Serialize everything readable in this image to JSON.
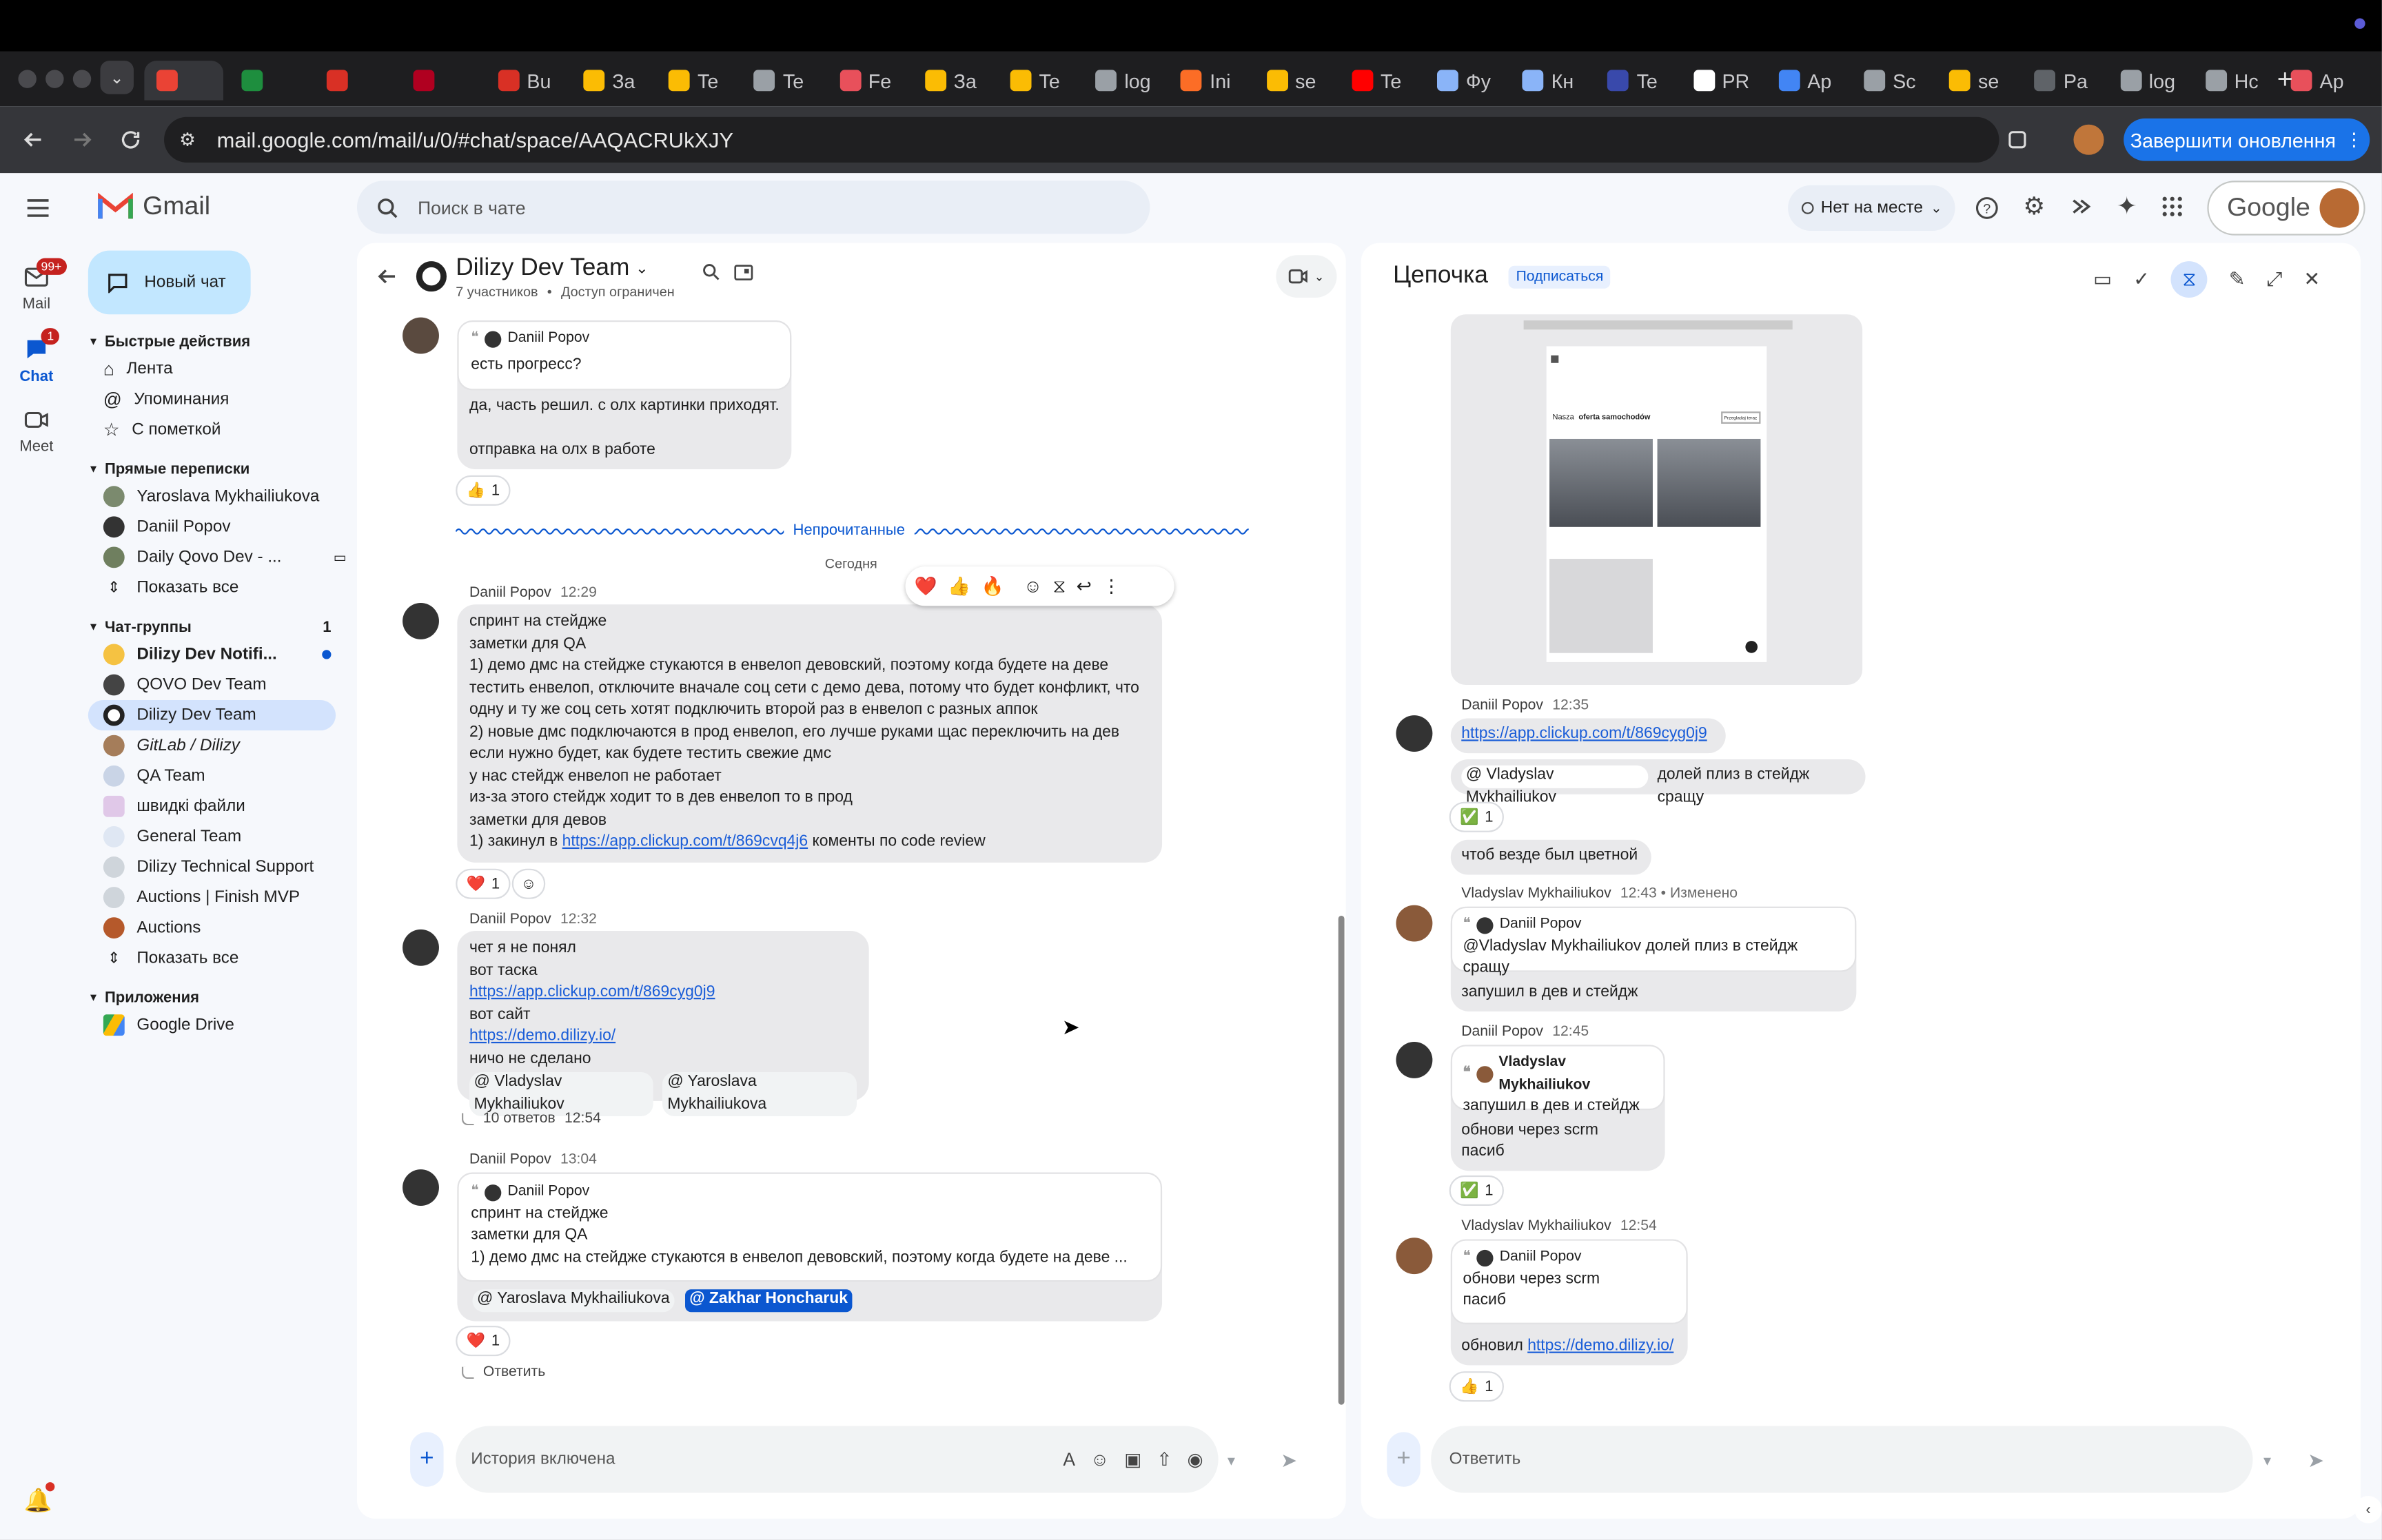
{
  "browser": {
    "tabs": [
      {
        "label": "",
        "color": "#ea4335"
      },
      {
        "label": "",
        "color": "#1e8e3e"
      },
      {
        "label": "",
        "color": "#d93025"
      },
      {
        "label": "",
        "color": "#b00020"
      },
      {
        "label": "Bu",
        "color": "#d93025"
      },
      {
        "label": "За",
        "color": "#fbbc04"
      },
      {
        "label": "Te",
        "color": "#fbbc04"
      },
      {
        "label": "Te",
        "color": "#9aa0a6"
      },
      {
        "label": "Fe",
        "color": "#e8505b"
      },
      {
        "label": "За",
        "color": "#fbbc04"
      },
      {
        "label": "Te",
        "color": "#fbbc04"
      },
      {
        "label": "log",
        "color": "#9aa0a6"
      },
      {
        "label": "Ini",
        "color": "#fc6d26"
      },
      {
        "label": "se",
        "color": "#fbbc04"
      },
      {
        "label": "Te",
        "color": "#ff0000"
      },
      {
        "label": "Фу",
        "color": "#8ab4f8"
      },
      {
        "label": "Кн",
        "color": "#8ab4f8"
      },
      {
        "label": "Te",
        "color": "#3949ab"
      },
      {
        "label": "PR",
        "color": "#ffffff"
      },
      {
        "label": "Ap",
        "color": "#4285f4"
      },
      {
        "label": "Sc",
        "color": "#9aa0a6"
      },
      {
        "label": "se",
        "color": "#fbbc04"
      },
      {
        "label": "Pa",
        "color": "#5f6368"
      },
      {
        "label": "log",
        "color": "#9aa0a6"
      },
      {
        "label": "Hc",
        "color": "#9aa0a6"
      },
      {
        "label": "Ap",
        "color": "#e8505b"
      }
    ],
    "new_tab": "+",
    "url": "mail.google.com/mail/u/0/#chat/space/AAQACRUkXJY",
    "update_button": "Завершити оновлення"
  },
  "gmail": {
    "logo_text": "Gmail",
    "search_placeholder": "Поиск в чате",
    "status": "Нет на месте",
    "google_text": "Google",
    "rail": {
      "mail": "Mail",
      "mail_badge": "99+",
      "chat": "Chat",
      "chat_badge": "1",
      "meet": "Meet"
    },
    "new_chat": "Новый чат",
    "sections": {
      "quick": "Быстрые действия",
      "quick_items": [
        "Лента",
        "Упоминания",
        "С пометкой"
      ],
      "dm": "Прямые переписки",
      "dm_items": [
        "Yaroslava Mykhailiukova",
        "Daniil Popov",
        "Daily Qovo Dev - ..."
      ],
      "show_all": "Показать все",
      "groups": "Чат-группы",
      "groups_count": "1",
      "group_items": [
        "Dilizy Dev Notifi...",
        "QOVO Dev Team",
        "Dilizy Dev Team",
        "GitLab / Dilizy",
        "QA Team",
        "швидкі файли",
        "General Team",
        "Dilizy Technical Support",
        "Auctions | Finish MVP",
        "Auctions"
      ],
      "apps": "Приложения",
      "app_items": [
        "Google Drive"
      ]
    }
  },
  "chat": {
    "title": "Dilizy Dev Team",
    "subtitle_members": "7 участников",
    "subtitle_access": "Доступ ограничен",
    "unread_label": "Непрочитанные",
    "today_label": "Сегодня",
    "msg0": {
      "quote_author": "Daniil Popov",
      "quote_text": "есть прогресс?",
      "line1": "да, часть решил. с олх картинки приходят.",
      "line2": "отправка на олх в работе",
      "reaction": "1"
    },
    "msg1": {
      "author": "Daniil Popov",
      "time": "12:29",
      "lines": [
        "спринт на стейдже",
        "заметки для QA",
        "1) демо дмс на стейдже стукаются в енвелоп девовский, поэтому когда будете на деве",
        "тестить енвелоп, отключите вначале соц сети с демо дева, потому что будет конфликт, что",
        "одну и ту же соц сеть хотят подключить второй раз в енвелоп с разных аппок",
        "2) новые дмс подключаются в прод енвелоп, его лучше руками щас переключить на дев",
        "если нужно будет, как будете тестить свежие дмс",
        "у нас стейдж енвелоп не работает",
        "из-за этого стейдж ходит то в дев енвелоп то в прод",
        "заметки для девов"
      ],
      "last_prefix": "1) закинул в ",
      "last_link": "https://app.clickup.com/t/869cvq4j6",
      "last_suffix": " коменты по code review",
      "reaction": "1"
    },
    "msg2": {
      "author": "Daniil Popov",
      "time": "12:32",
      "line1": "чет я не понял",
      "line2": "вот таска",
      "link1": "https://app.clickup.com/t/869cyg0j9",
      "line3": "вот сайт",
      "link2": "https://demo.dilizy.io/",
      "line4": "ничо не сделано",
      "mention1": "@ Vladyslav Mykhailiukov",
      "mention2": "@ Yaroslava Mykhailiukova",
      "replies": "10 ответов",
      "replies_time": "12:54"
    },
    "msg3": {
      "author": "Daniil Popov",
      "time": "13:04",
      "quote_author": "Daniil Popov",
      "quote_lines": [
        "спринт на стейдже",
        "заметки для QA",
        "1) демо дмс на стейдже стукаются в енвелоп девовский, поэтому когда будете на деве ..."
      ],
      "mention1": "@ Yaroslava Mykhailiukova",
      "mention2": "@ Zakhar Honcharuk",
      "reaction": "1",
      "reply": "Ответить"
    },
    "composer_placeholder": "История включена"
  },
  "thread": {
    "title": "Цепочка",
    "subscribe": "Подписаться",
    "image": {
      "heading_a": "Nasza",
      "heading_b": "oferta samochodów",
      "button": "Przegladaj teraz"
    },
    "t1": {
      "author": "Daniil Popov",
      "time": "12:35",
      "link": "https://app.clickup.com/t/869cyg0j9",
      "mention": "@ Vladyslav Mykhailiukov",
      "text": "долей плиз в стейдж сращу",
      "reaction": "1",
      "text2": "чтоб везде был цветной"
    },
    "t2": {
      "author": "Vladyslav Mykhailiukov",
      "time": "12:43",
      "edited": "Изменено",
      "quote_author": "Daniil Popov",
      "quote_text": "@Vladyslav Mykhailiukov долей плиз в стейдж сращу",
      "text": "запушил в дев и стейдж"
    },
    "t3": {
      "author": "Daniil Popov",
      "time": "12:45",
      "quote_author": "Vladyslav Mykhailiukov",
      "quote_text": "запушил в дев и стейдж",
      "line1": "обнови через scrm",
      "line2": "пасиб",
      "reaction": "1"
    },
    "t4": {
      "author": "Vladyslav Mykhailiukov",
      "time": "12:54",
      "quote_author": "Daniil Popov",
      "quote_line1": "обнови через scrm",
      "quote_line2": "пасиб",
      "text_prefix": "обновил ",
      "link": "https://demo.dilizy.io/",
      "reaction": "1"
    },
    "composer_placeholder": "Ответить"
  },
  "colors": {
    "accent": "#1a73e8",
    "selected": "#d3e3fd",
    "unread_blue": "#0b57d0"
  }
}
